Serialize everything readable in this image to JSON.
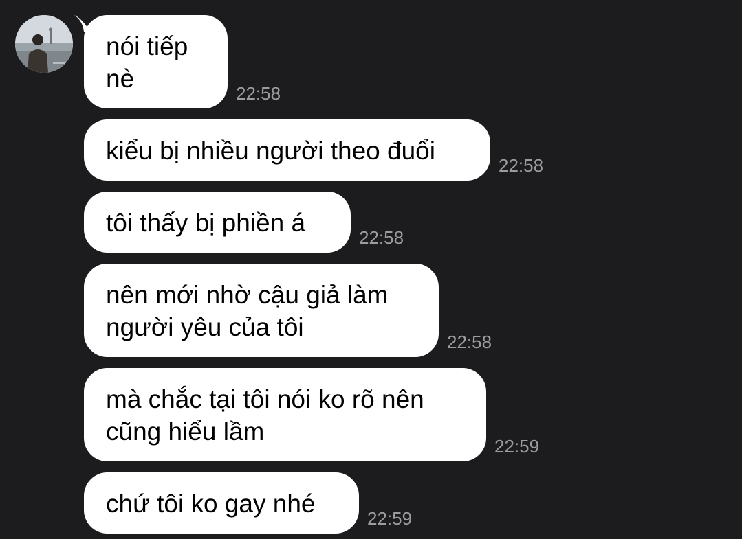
{
  "contact": {
    "avatar_icon": "profile-photo"
  },
  "messages": [
    {
      "text": "nói tiếp\nnè",
      "time": "22:58"
    },
    {
      "text": "kiểu bị nhiều người theo đuổi",
      "time": "22:58"
    },
    {
      "text": "tôi thấy bị phiền á",
      "time": "22:58"
    },
    {
      "text": "nên mới nhờ cậu giả làm\nngười yêu của tôi",
      "time": "22:58"
    },
    {
      "text": "mà chắc tại tôi nói ko rõ nên\ncũng hiểu lầm",
      "time": "22:59"
    },
    {
      "text": "chứ tôi ko gay nhé",
      "time": "22:59"
    }
  ],
  "colors": {
    "background": "#1c1c1e",
    "bubble": "#ffffff",
    "timestamp": "#9c9ca0"
  }
}
